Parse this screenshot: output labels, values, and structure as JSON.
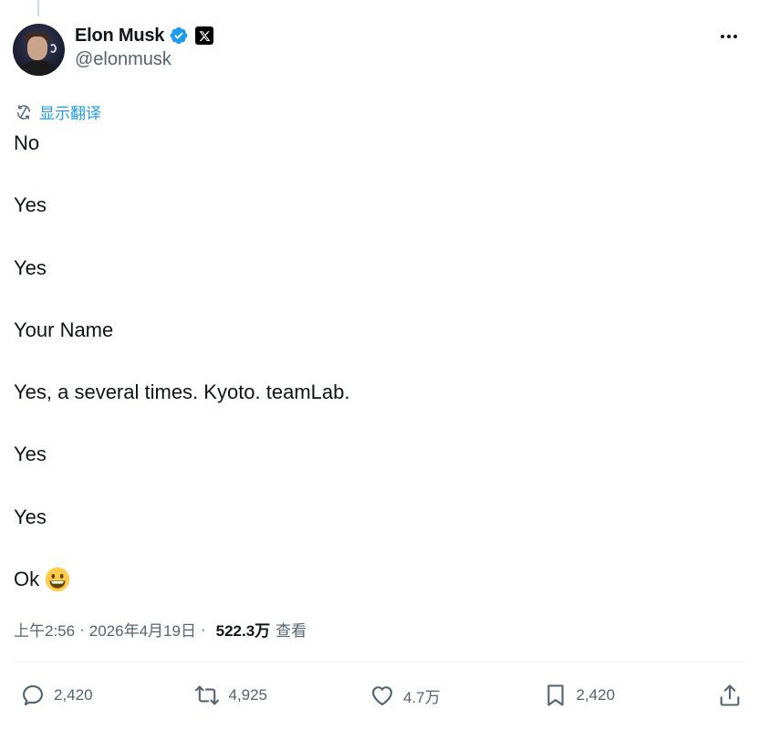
{
  "author": {
    "display_name": "Elon Musk",
    "handle": "@elonmusk",
    "verified_color": "#1d9bf0"
  },
  "translate": {
    "label": "显示翻译",
    "icon": "translate-icon"
  },
  "tweet": {
    "lines": [
      "No",
      "Yes",
      "Yes",
      "Your Name",
      "Yes, a several times. Kyoto. teamLab.",
      "Yes",
      "Yes",
      "Ok"
    ],
    "emoji": "grinning-face-emoji"
  },
  "meta": {
    "time": "上午2:56",
    "date": "2026年4月19日",
    "separator": "·",
    "views": "522.3万",
    "views_label": "查看"
  },
  "actions": {
    "reply_count": "2,420",
    "retweet_count": "4,925",
    "like_count": "4.7万",
    "bookmark_count": "2,420"
  },
  "colors": {
    "accent": "#1d9bf0",
    "text": "#0f1419",
    "secondary": "#536471"
  }
}
